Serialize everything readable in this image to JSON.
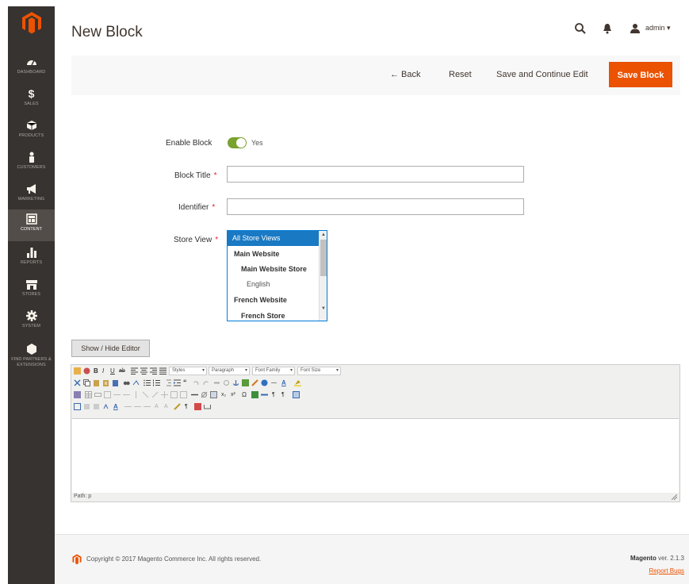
{
  "sidebar": {
    "items": [
      {
        "label": "DASHBOARD",
        "icon": "dashboard-icon"
      },
      {
        "label": "SALES",
        "icon": "dollar-icon"
      },
      {
        "label": "PRODUCTS",
        "icon": "cube-icon"
      },
      {
        "label": "CUSTOMERS",
        "icon": "person-icon"
      },
      {
        "label": "MARKETING",
        "icon": "megaphone-icon"
      },
      {
        "label": "CONTENT",
        "icon": "layout-icon",
        "active": true
      },
      {
        "label": "REPORTS",
        "icon": "bar-chart-icon"
      },
      {
        "label": "STORES",
        "icon": "storefront-icon"
      },
      {
        "label": "SYSTEM",
        "icon": "gear-icon"
      },
      {
        "label": "FIND PARTNERS & EXTENSIONS",
        "icon": "box-icon"
      }
    ]
  },
  "header": {
    "title": "New Block",
    "user": "admin ▾"
  },
  "actions": {
    "back": "← Back",
    "reset": "Reset",
    "save_continue": "Save and Continue Edit",
    "save": "Save Block"
  },
  "form": {
    "enable_label": "Enable Block",
    "enable_value": "Yes",
    "title_label": "Block Title",
    "title_value": "",
    "identifier_label": "Identifier",
    "identifier_value": "",
    "required_mark": "*",
    "store_view_label": "Store View",
    "store_options": [
      {
        "label": "All Store Views",
        "selected": true,
        "bold": false,
        "indent": 0
      },
      {
        "label": "Main Website",
        "selected": false,
        "bold": true,
        "indent": 0
      },
      {
        "label": "Main Website Store",
        "selected": false,
        "bold": true,
        "indent": 1
      },
      {
        "label": "English",
        "selected": false,
        "bold": false,
        "indent": 2
      },
      {
        "label": "French Website",
        "selected": false,
        "bold": true,
        "indent": 0
      },
      {
        "label": "French Store",
        "selected": false,
        "bold": true,
        "indent": 1
      }
    ]
  },
  "editor": {
    "toggle_label": "Show / Hide Editor",
    "styles": "Styles",
    "paragraph": "Paragraph",
    "font_family": "Font Family",
    "font_size": "Font Size",
    "path": "Path: p"
  },
  "footer": {
    "copyright": "Copyright © 2017 Magento Commerce Inc. All rights reserved.",
    "brand": "Magento",
    "version": " ver. 2.1.3",
    "report_bugs": "Report Bugs"
  },
  "colors": {
    "accent": "#eb5202",
    "sidebar": "#373330",
    "toggle_on": "#79a22e",
    "selection": "#1979c3"
  }
}
